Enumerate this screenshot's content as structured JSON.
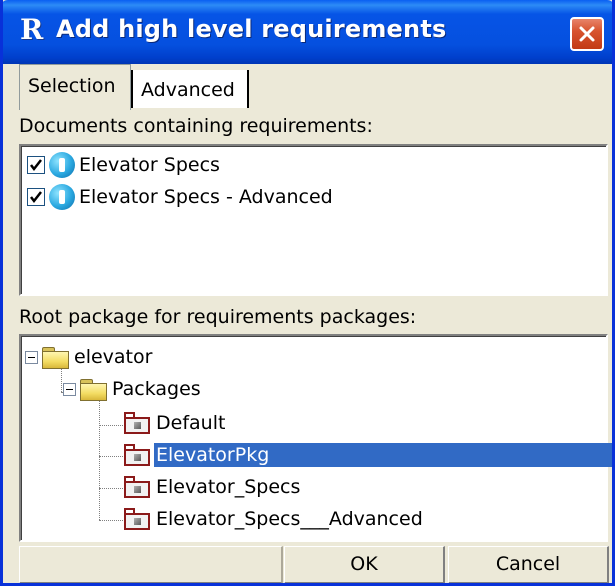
{
  "window": {
    "title": "Add high level requirements",
    "app_icon_glyph": "R"
  },
  "tabs": [
    {
      "label": "Selection",
      "active": true
    },
    {
      "label": "Advanced",
      "active": false
    }
  ],
  "documents": {
    "label": "Documents containing requirements:",
    "items": [
      {
        "label": "Elevator Specs",
        "checked": true
      },
      {
        "label": "Elevator Specs - Advanced",
        "checked": true
      }
    ]
  },
  "packages": {
    "label": "Root package for requirements packages:",
    "tree": {
      "root": "elevator",
      "child": "Packages",
      "leaves": [
        "Default",
        "ElevatorPkg",
        "Elevator_Specs",
        "Elevator_Specs___Advanced"
      ],
      "selected": "ElevatorPkg"
    }
  },
  "buttons": {
    "ok": "OK",
    "cancel": "Cancel"
  },
  "colors": {
    "selection": "#316ac5",
    "titlebar": "#0654e6",
    "close": "#d8542f"
  }
}
